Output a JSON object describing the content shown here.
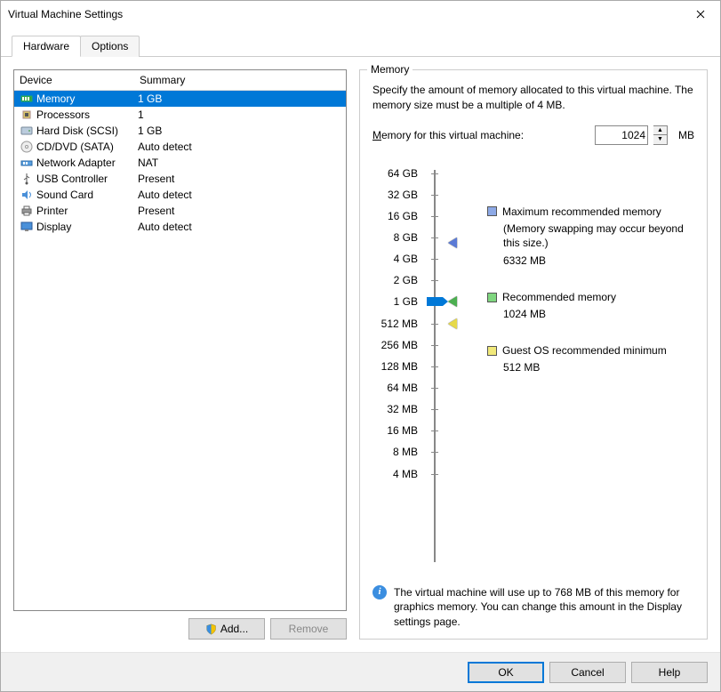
{
  "window": {
    "title": "Virtual Machine Settings"
  },
  "tabs": {
    "hardware": "Hardware",
    "options": "Options"
  },
  "deviceList": {
    "headers": {
      "device": "Device",
      "summary": "Summary"
    },
    "rows": [
      {
        "name": "Memory",
        "summary": "1 GB",
        "icon": "memory-icon",
        "selected": true
      },
      {
        "name": "Processors",
        "summary": "1",
        "icon": "cpu-icon"
      },
      {
        "name": "Hard Disk (SCSI)",
        "summary": "1 GB",
        "icon": "hdd-icon"
      },
      {
        "name": "CD/DVD (SATA)",
        "summary": "Auto detect",
        "icon": "cd-icon"
      },
      {
        "name": "Network Adapter",
        "summary": "NAT",
        "icon": "network-icon"
      },
      {
        "name": "USB Controller",
        "summary": "Present",
        "icon": "usb-icon"
      },
      {
        "name": "Sound Card",
        "summary": "Auto detect",
        "icon": "sound-icon"
      },
      {
        "name": "Printer",
        "summary": "Present",
        "icon": "printer-icon"
      },
      {
        "name": "Display",
        "summary": "Auto detect",
        "icon": "display-icon"
      }
    ],
    "addLabel": "Add...",
    "removeLabel": "Remove"
  },
  "memoryPanel": {
    "group": "Memory",
    "desc": "Specify the amount of memory allocated to this virtual machine. The memory size must be a multiple of 4 MB.",
    "inputLabelPre": "M",
    "inputLabelRest": "emory for this virtual machine:",
    "value": "1024",
    "unit": "MB",
    "ticks": [
      "64 GB",
      "32 GB",
      "16 GB",
      "8 GB",
      "4 GB",
      "2 GB",
      "1 GB",
      "512 MB",
      "256 MB",
      "128 MB",
      "64 MB",
      "32 MB",
      "16 MB",
      "8 MB",
      "4 MB"
    ],
    "legend": {
      "max": {
        "title": "Maximum recommended memory",
        "sub": "(Memory swapping may occur beyond this size.)",
        "value": "6332 MB"
      },
      "rec": {
        "title": "Recommended memory",
        "value": "1024 MB"
      },
      "min": {
        "title": "Guest OS recommended minimum",
        "value": "512 MB"
      }
    },
    "info": "The virtual machine will use up to 768 MB of this memory for graphics memory. You can change this amount in the Display settings page."
  },
  "footer": {
    "ok": "OK",
    "cancel": "Cancel",
    "help": "Help"
  }
}
